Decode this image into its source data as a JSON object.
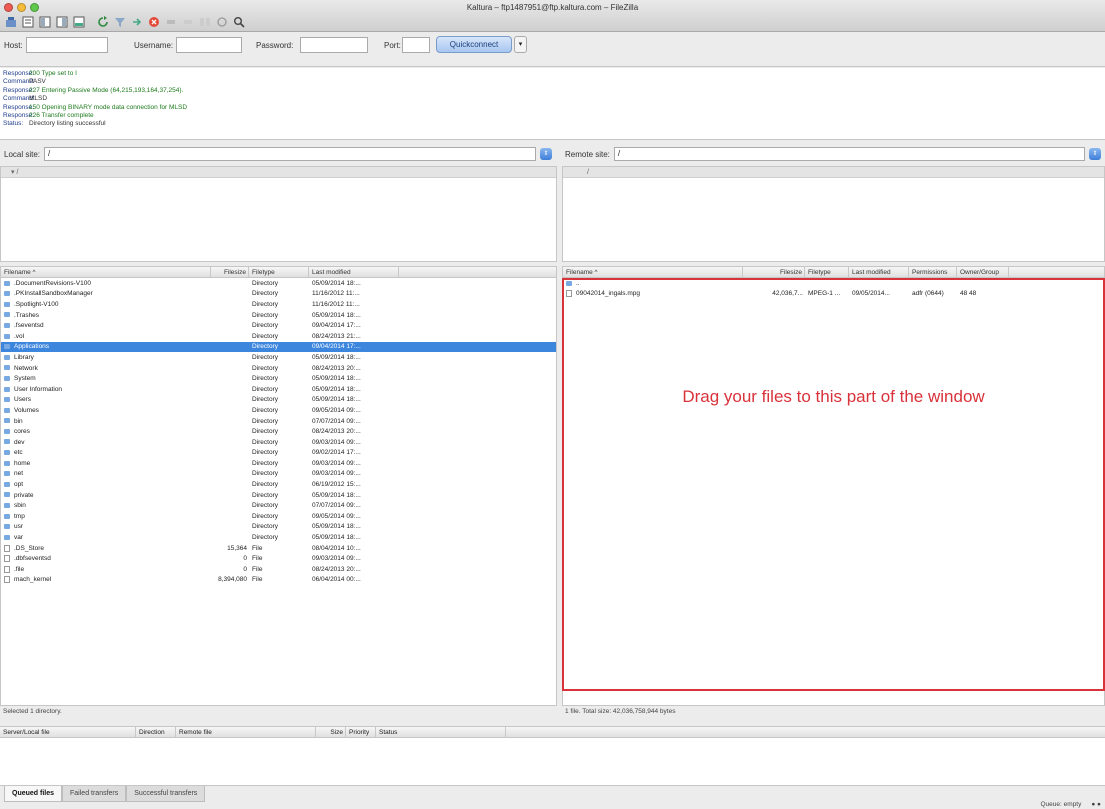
{
  "window": {
    "title": "Kaltura – ftp1487951@ftp.kaltura.com – FileZilla",
    "traffic_lights": [
      "#ee5b52",
      "#f5bd3a",
      "#60c84a"
    ]
  },
  "toolbar": {
    "icons": [
      "site-manager-icon",
      "message-log-icon",
      "local-tree-icon",
      "remote-tree-icon",
      "queue-icon",
      "refresh-icon",
      "filter-icon",
      "process-queue-icon",
      "cancel-icon",
      "disconnect-icon",
      "reconnect-icon",
      "compare-icon",
      "sync-browse-icon",
      "search-icon"
    ]
  },
  "quickconnect": {
    "host_label": "Host:",
    "host_value": "",
    "username_label": "Username:",
    "username_value": "",
    "password_label": "Password:",
    "password_value": "",
    "port_label": "Port:",
    "port_value": "",
    "button_label": "Quickconnect",
    "arrow": "▾"
  },
  "log": [
    {
      "label": "Response:",
      "text": "200 Type set to I"
    },
    {
      "label": "Command:",
      "text": "PASV"
    },
    {
      "label": "Response:",
      "text": "227 Entering Passive Mode (64,215,193,164,37,254)."
    },
    {
      "label": "Command:",
      "text": "MLSD"
    },
    {
      "label": "Response:",
      "text": "150 Opening BINARY mode data connection for MLSD"
    },
    {
      "label": "Response:",
      "text": "226 Transfer complete"
    },
    {
      "label": "Status:",
      "text": "Directory listing successful"
    }
  ],
  "local": {
    "site_label": "Local site:",
    "site_value": "/",
    "tree_root": "▾  /",
    "columns": [
      "Filename ^",
      "Filesize",
      "Filetype",
      "Last modified"
    ],
    "rows": [
      {
        "name": ".DocumentRevisions-V100",
        "size": "",
        "type": "Directory",
        "modified": "05/09/2014 18:...",
        "kind": "dir"
      },
      {
        "name": ".PKInstallSandboxManager",
        "size": "",
        "type": "Directory",
        "modified": "11/16/2012 11:...",
        "kind": "dir"
      },
      {
        "name": ".Spotlight-V100",
        "size": "",
        "type": "Directory",
        "modified": "11/16/2012 11:...",
        "kind": "dir"
      },
      {
        "name": ".Trashes",
        "size": "",
        "type": "Directory",
        "modified": "05/09/2014 18:...",
        "kind": "dir"
      },
      {
        "name": ".fseventsd",
        "size": "",
        "type": "Directory",
        "modified": "09/04/2014 17:...",
        "kind": "dir"
      },
      {
        "name": ".vol",
        "size": "",
        "type": "Directory",
        "modified": "08/24/2013 21:...",
        "kind": "dir"
      },
      {
        "name": "Applications",
        "size": "",
        "type": "Directory",
        "modified": "09/04/2014 17:...",
        "kind": "dir",
        "selected": true
      },
      {
        "name": "Library",
        "size": "",
        "type": "Directory",
        "modified": "05/09/2014 18:...",
        "kind": "dir"
      },
      {
        "name": "Network",
        "size": "",
        "type": "Directory",
        "modified": "08/24/2013 20:...",
        "kind": "dir"
      },
      {
        "name": "System",
        "size": "",
        "type": "Directory",
        "modified": "05/09/2014 18:...",
        "kind": "dir"
      },
      {
        "name": "User Information",
        "size": "",
        "type": "Directory",
        "modified": "05/09/2014 18:...",
        "kind": "dir"
      },
      {
        "name": "Users",
        "size": "",
        "type": "Directory",
        "modified": "05/09/2014 18:...",
        "kind": "dir"
      },
      {
        "name": "Volumes",
        "size": "",
        "type": "Directory",
        "modified": "09/05/2014 09:...",
        "kind": "dir"
      },
      {
        "name": "bin",
        "size": "",
        "type": "Directory",
        "modified": "07/07/2014 09:...",
        "kind": "dir"
      },
      {
        "name": "cores",
        "size": "",
        "type": "Directory",
        "modified": "08/24/2013 20:...",
        "kind": "dir"
      },
      {
        "name": "dev",
        "size": "",
        "type": "Directory",
        "modified": "09/03/2014 09:...",
        "kind": "dir"
      },
      {
        "name": "etc",
        "size": "",
        "type": "Directory",
        "modified": "09/02/2014 17:...",
        "kind": "dir"
      },
      {
        "name": "home",
        "size": "",
        "type": "Directory",
        "modified": "09/03/2014 09:...",
        "kind": "dir"
      },
      {
        "name": "net",
        "size": "",
        "type": "Directory",
        "modified": "09/03/2014 09:...",
        "kind": "dir"
      },
      {
        "name": "opt",
        "size": "",
        "type": "Directory",
        "modified": "06/19/2012 15:...",
        "kind": "dir"
      },
      {
        "name": "private",
        "size": "",
        "type": "Directory",
        "modified": "05/09/2014 18:...",
        "kind": "dir"
      },
      {
        "name": "sbin",
        "size": "",
        "type": "Directory",
        "modified": "07/07/2014 09:...",
        "kind": "dir"
      },
      {
        "name": "tmp",
        "size": "",
        "type": "Directory",
        "modified": "09/05/2014 09:...",
        "kind": "dir"
      },
      {
        "name": "usr",
        "size": "",
        "type": "Directory",
        "modified": "05/09/2014 18:...",
        "kind": "dir"
      },
      {
        "name": "var",
        "size": "",
        "type": "Directory",
        "modified": "05/09/2014 18:...",
        "kind": "dir"
      },
      {
        "name": ".DS_Store",
        "size": "15,364",
        "type": "File",
        "modified": "08/04/2014 10:...",
        "kind": "file"
      },
      {
        "name": ".dbfseventsd",
        "size": "0",
        "type": "File",
        "modified": "09/03/2014 09:...",
        "kind": "file"
      },
      {
        "name": ".file",
        "size": "0",
        "type": "File",
        "modified": "08/24/2013 20:...",
        "kind": "file"
      },
      {
        "name": "mach_kernel",
        "size": "8,394,080",
        "type": "File",
        "modified": "06/04/2014 00:...",
        "kind": "file"
      }
    ],
    "status": "Selected 1 directory."
  },
  "remote": {
    "site_label": "Remote site:",
    "site_value": "/",
    "tree_root": "/",
    "columns": [
      "Filename ^",
      "Filesize",
      "Filetype",
      "Last modified",
      "Permissions",
      "Owner/Group"
    ],
    "rows": [
      {
        "name": "..",
        "size": "",
        "type": "",
        "modified": "",
        "perms": "",
        "owner": "",
        "kind": "dir"
      },
      {
        "name": "09042014_ingals.mpg",
        "size": "42,036,7...",
        "type": "MPEG-1 ...",
        "modified": "09/05/2014...",
        "perms": "adfr (0644)",
        "owner": "48 48",
        "kind": "file"
      }
    ],
    "status": "1 file. Total size: 42,036,758,944 bytes",
    "drop_hint": "Drag your files to this part of the window",
    "drop_color": "#d8323a"
  },
  "queue": {
    "columns": [
      "Server/Local file",
      "Direction",
      "Remote file",
      "Size",
      "Priority",
      "Status"
    ],
    "tabs": [
      "Queued files",
      "Failed transfers",
      "Successful transfers"
    ],
    "status_right": [
      "Queue: empty",
      "● ●"
    ]
  }
}
